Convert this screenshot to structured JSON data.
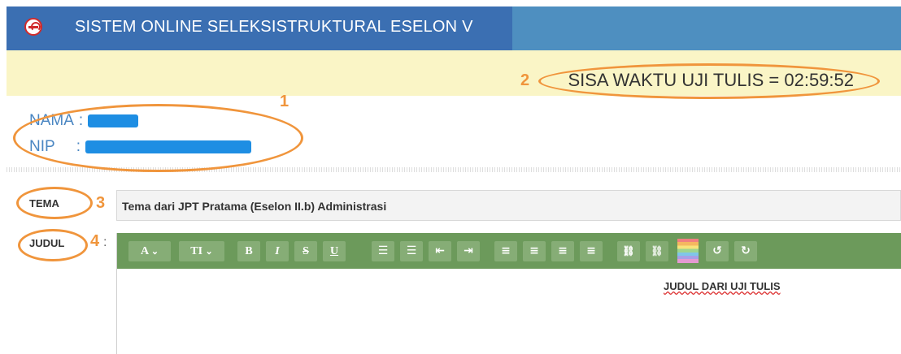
{
  "header": {
    "title": "SISTEM ONLINE SELEKSISTRUKTURAL ESELON V",
    "logo_icon": "e-logo-icon"
  },
  "timer": {
    "text": "SISA WAKTU UJI TULIS = 02:59:52"
  },
  "identity": {
    "name_label": "NAMA",
    "nip_label": "NIP",
    "colon": ":"
  },
  "form": {
    "tema_label": "TEMA",
    "tema_value": "Tema dari JPT Pratama (Eselon II.b) Administrasi",
    "judul_label": "JUDUL",
    "colon": ":"
  },
  "editor": {
    "toolbar": {
      "font": "A",
      "size": "TI",
      "bold": "B",
      "italic": "I",
      "strike": "S",
      "underline": "U",
      "dropdown_glyph": "⌄",
      "unordered_list_glyph": "☰",
      "ordered_list_glyph": "☰",
      "outdent_glyph": "⇤",
      "indent_glyph": "⇥",
      "align_left_glyph": "≡",
      "align_center_glyph": "≡",
      "align_right_glyph": "≡",
      "justify_glyph": "≡",
      "link_glyph": "⛓",
      "unlink_glyph": "⛓",
      "undo_glyph": "↺",
      "redo_glyph": "↻"
    },
    "content": "JUDUL DARI UJI TULIS"
  },
  "annotations": {
    "n1": "1",
    "n2": "2",
    "n3": "3",
    "n4": "4"
  },
  "colors": {
    "header": "#3b6fb2",
    "header_right": "#4e8fc0",
    "timer_bg": "#faf5c6",
    "toolbar": "#6c9a5b",
    "annotation": "#f0953c",
    "redaction": "#1e8ee3"
  }
}
